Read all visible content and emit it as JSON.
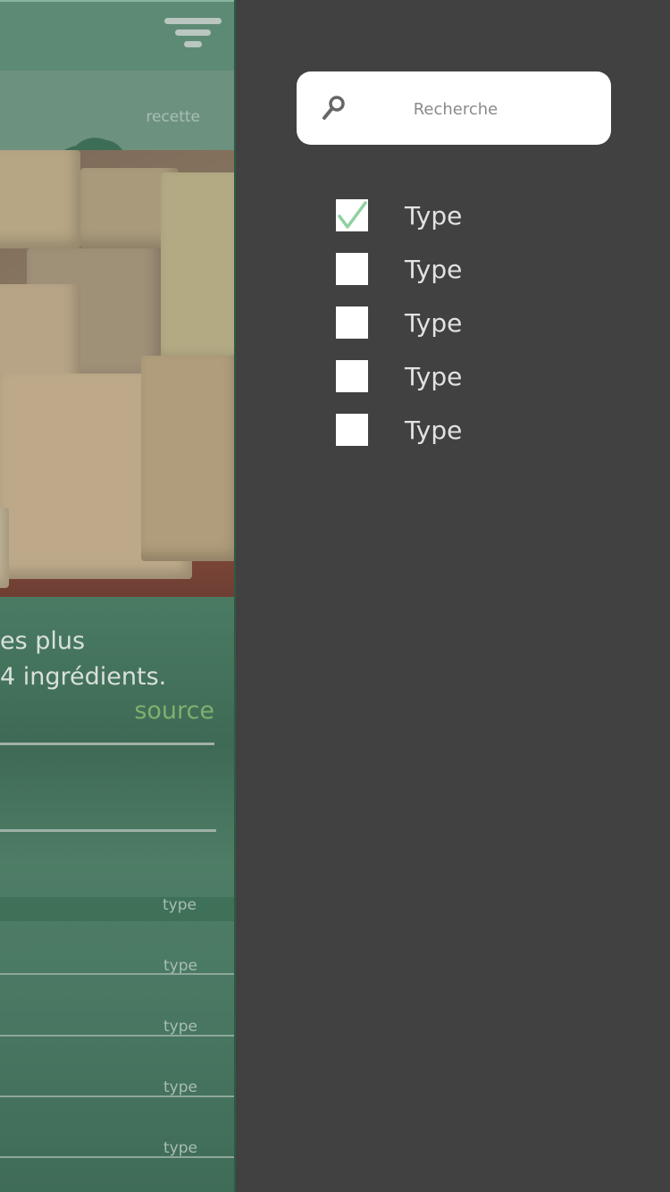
{
  "header": {
    "filter_icon": "filter-icon"
  },
  "recette": {
    "label": "recette"
  },
  "description": {
    "line1": "es plus",
    "line2": "4 ingrédients."
  },
  "source_link": "source",
  "type_list": [
    "type",
    "type",
    "type",
    "type",
    "type"
  ],
  "drawer": {
    "search": {
      "placeholder": "Recherche",
      "icon": "search-icon"
    },
    "options": [
      {
        "label": "Type",
        "checked": true
      },
      {
        "label": "Type",
        "checked": false
      },
      {
        "label": "Type",
        "checked": false
      },
      {
        "label": "Type",
        "checked": false
      },
      {
        "label": "Type",
        "checked": false
      }
    ]
  },
  "colors": {
    "drawer_bg": "#414141",
    "check": "#8fd19e",
    "accent_green": "#7fb06e"
  }
}
